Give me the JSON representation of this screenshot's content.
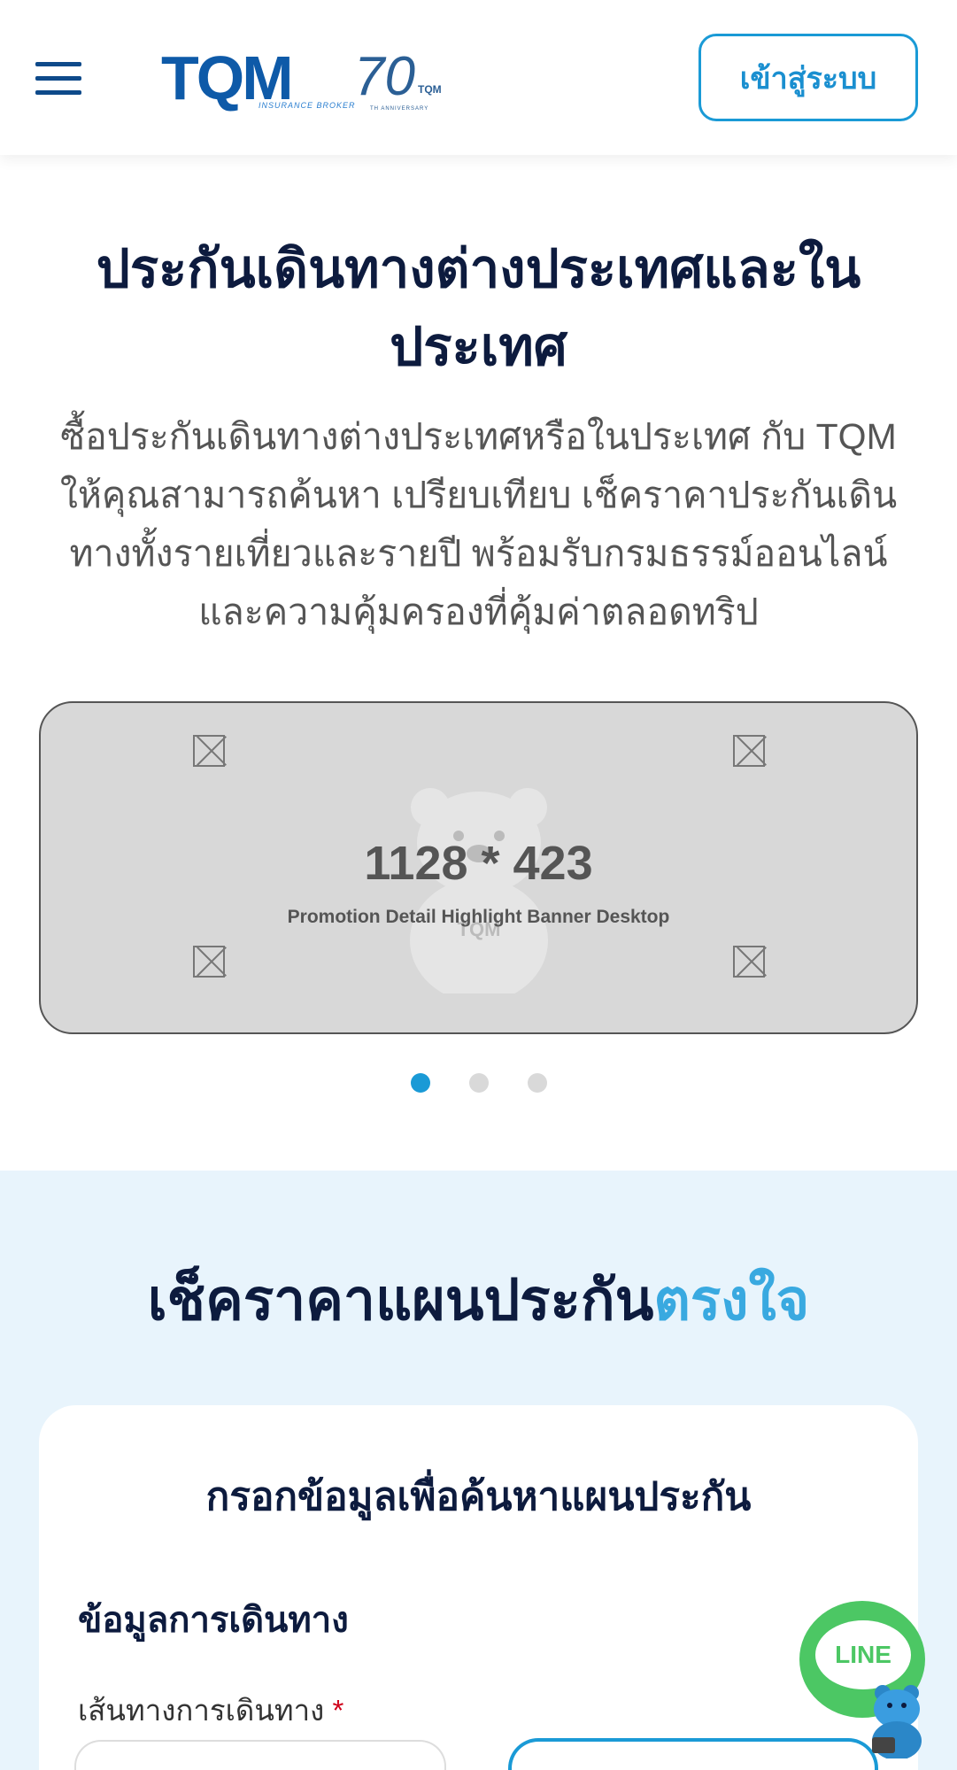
{
  "header": {
    "login_label": "เข้าสู่ระบบ",
    "logo": {
      "brand": "TQM",
      "sub": "INSURANCE BROKER",
      "anniversary_number": "70",
      "anniversary_brand": "TQM",
      "anniversary_text": "TH ANNIVERSARY"
    }
  },
  "hero": {
    "title": "ประกันเดินทางต่างประเทศและในประเทศ",
    "description": "ซื้อประกันเดินทางต่างประเทศหรือในประเทศ กับ TQM ให้คุณสามารถค้นหา เปรียบเทียบ เช็คราคาประกันเดินทางทั้งรายเที่ยวและรายปี พร้อมรับกรมธรรม์ออนไลน์และความคุ้มครองที่คุ้มค่าตลอดทริป"
  },
  "banner": {
    "size_text": "1128 * 423",
    "caption": "Promotion Detail Highlight Banner Desktop",
    "watermark": "TQM",
    "slide_count": 3,
    "active_slide": 1
  },
  "check_section": {
    "title_prefix": "เช็คราคาแผนประกัน",
    "title_highlight": "ตรงใจ"
  },
  "form": {
    "title": "กรอกข้อมูลเพื่อค้นหาแผนประกัน",
    "section_label": "ข้อมูลการเดินทาง",
    "route_label": "เส้นทางการเดินทาง",
    "required_mark": "*"
  },
  "floating": {
    "line_label": "LINE"
  },
  "colors": {
    "brand_blue": "#0e5aa8",
    "accent": "#1a9ad6",
    "highlight": "#39a9e0",
    "section_bg": "#e8f4fc",
    "line_green": "#4cc764"
  }
}
